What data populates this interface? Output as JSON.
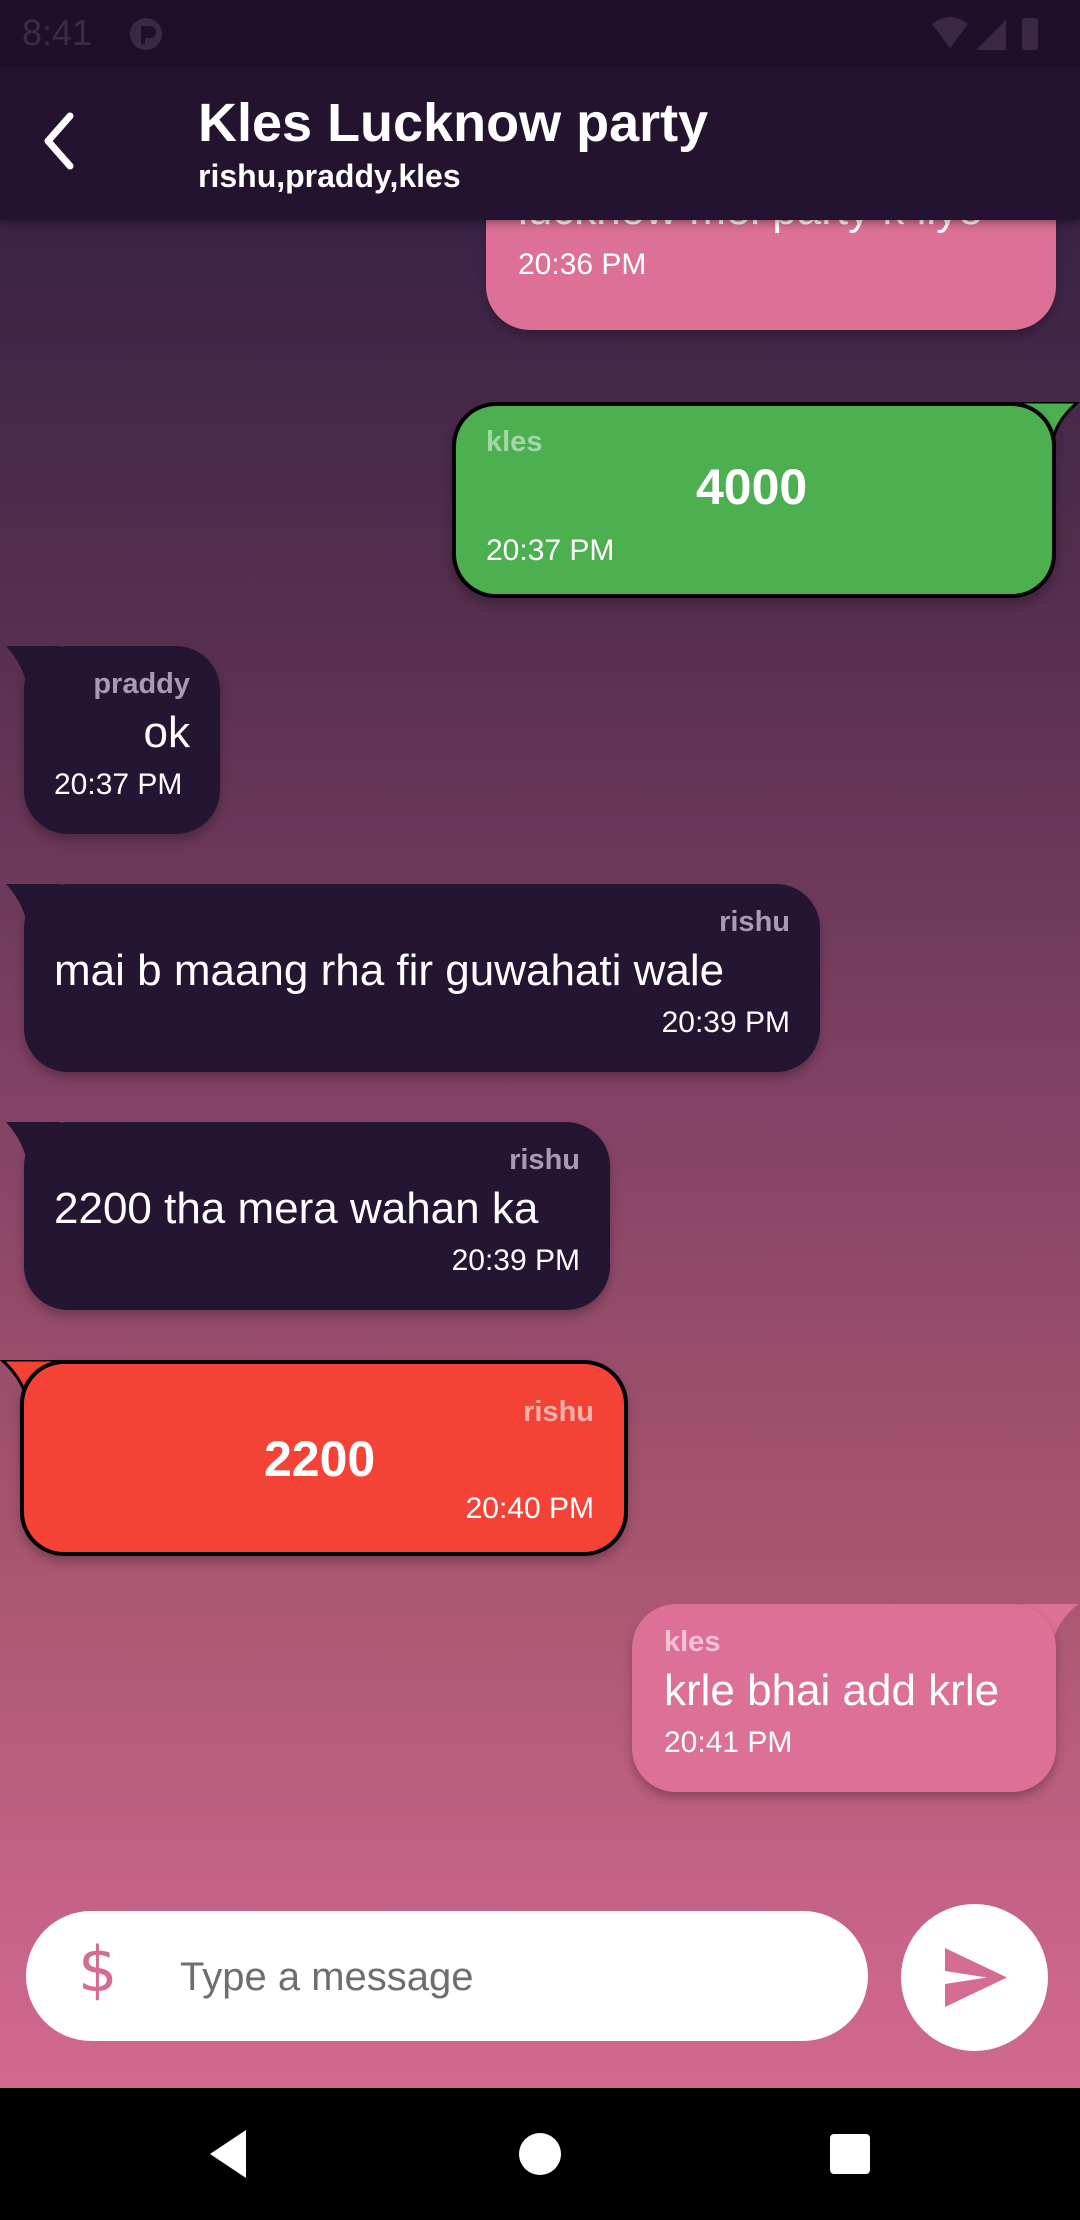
{
  "status_bar": {
    "time": "8:41"
  },
  "header": {
    "title": "Kles Lucknow party",
    "subtitle": "rishu,praddy,kles"
  },
  "messages": [
    {
      "side": "right",
      "style": "text",
      "sender": "",
      "text": "lucknow mei party k liye",
      "time": "20:36 PM",
      "color": "#dc7096"
    },
    {
      "side": "right",
      "style": "payment",
      "sender": "kles",
      "amount": "4000",
      "time": "20:37 PM",
      "color": "#4caf50"
    },
    {
      "side": "left",
      "style": "text",
      "sender": "praddy",
      "text": "ok",
      "time": "20:37 PM",
      "color": "#241532"
    },
    {
      "side": "left",
      "style": "text",
      "sender": "rishu",
      "text": "mai b maang rha fir guwahati wale",
      "time": "20:39 PM",
      "color": "#241532"
    },
    {
      "side": "left",
      "style": "text",
      "sender": "rishu",
      "text": "2200 tha mera wahan ka",
      "time": "20:39 PM",
      "color": "#241532"
    },
    {
      "side": "left",
      "style": "payment",
      "sender": "rishu",
      "amount": "2200",
      "time": "20:40 PM",
      "color": "#f44336"
    },
    {
      "side": "right",
      "style": "text",
      "sender": "kles",
      "text": "krle bhai add krle",
      "time": "20:41 PM",
      "color": "#dc7096"
    }
  ],
  "composer": {
    "placeholder": "Type a message",
    "currency_symbol": "$",
    "currency_icon": "dollar-icon",
    "send_icon": "send-icon"
  },
  "colors": {
    "accent": "#d46c93",
    "app_bar": "#24132f",
    "incoming_bubble": "#241532",
    "outgoing_bubble": "#dc7096",
    "payment_sent": "#4caf50",
    "payment_received": "#f44336"
  }
}
